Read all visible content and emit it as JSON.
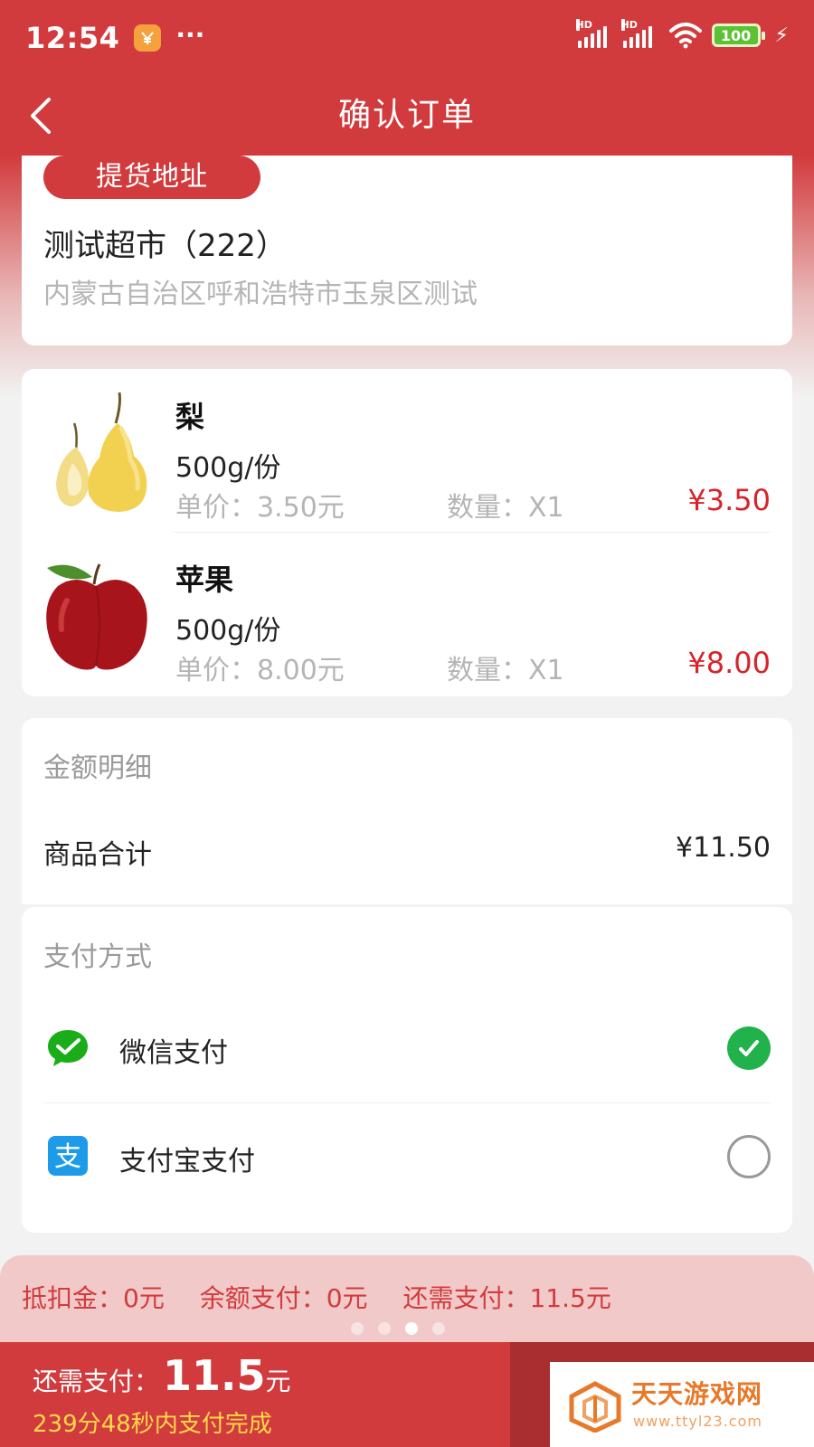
{
  "status_bar": {
    "time": "12:54",
    "dots": "···",
    "battery": "100"
  },
  "nav": {
    "title": "确认订单"
  },
  "address": {
    "tag": "提货地址",
    "store_name": "测试超市（222）",
    "address": "内蒙古自治区呼和浩特市玉泉区测试"
  },
  "products": [
    {
      "name": "梨",
      "spec": "500g/份",
      "unit_price": "单价：3.50元",
      "quantity": "数量：X1",
      "price": "¥3.50",
      "icon": "pear-image"
    },
    {
      "name": "苹果",
      "spec": "500g/份",
      "unit_price": "单价：8.00元",
      "quantity": "数量：X1",
      "price": "¥8.00",
      "icon": "apple-image"
    }
  ],
  "amount": {
    "section_title": "金额明细",
    "goods_total_label": "商品合计",
    "goods_total_value": "¥11.50"
  },
  "payment": {
    "section_title": "支付方式",
    "methods": [
      {
        "label": "微信支付",
        "icon": "wechat-pay-icon",
        "selected": true
      },
      {
        "label": "支付宝支付",
        "icon": "alipay-icon",
        "selected": false
      }
    ]
  },
  "summary": {
    "deduction": "抵扣金：0元",
    "balance": "余额支付：0元",
    "remaining": "还需支付：11.5元",
    "page_count": 4,
    "active_page": 3
  },
  "bottom": {
    "label": "还需支付：",
    "amount": "11.5",
    "unit": "元",
    "countdown": "239分48秒内支付完成"
  },
  "watermark": {
    "text": "天天游戏网",
    "url": "www.ttyl23.com"
  },
  "colors": {
    "brand_red": "#d23b3d",
    "price_red": "#d8232a",
    "wechat_green": "#22b24c",
    "alipay_blue": "#1e9be8",
    "countdown_yellow": "#ffd94a"
  }
}
